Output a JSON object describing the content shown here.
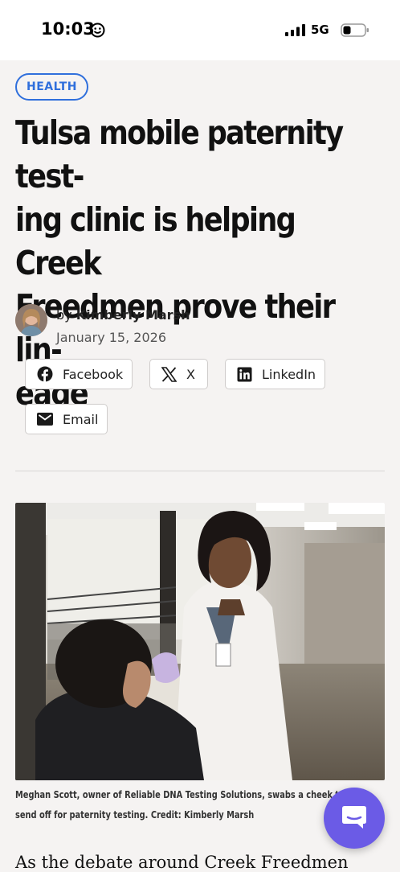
{
  "status_bar": {
    "time": "10:03",
    "network": "5G",
    "smiley_icon": "smiley-icon",
    "signal_icon": "signal-icon",
    "battery_icon": "battery-icon"
  },
  "article": {
    "category": "HEALTH",
    "headline_lines": [
      "Tulsa mobile paternity test-",
      "ing clinic is helping Creek",
      "Freedmen prove their lin-",
      "eage"
    ],
    "byline_prefix": "by",
    "author": "Kimberly Marsh",
    "date": "January 15, 2026",
    "caption": "Meghan Scott, owner of Reliable DNA Testing Solutions, swabs a cheek to send off for paternity testing. Credit: Kimberly Marsh",
    "body_start": "As the debate around Creek Freedmen"
  },
  "share": {
    "facebook": "Facebook",
    "x": "X",
    "linkedin": "LinkedIn",
    "email": "Email"
  },
  "colors": {
    "accent": "#2f6fdc",
    "fab": "#6b5be6",
    "background": "#f5f3f2"
  }
}
